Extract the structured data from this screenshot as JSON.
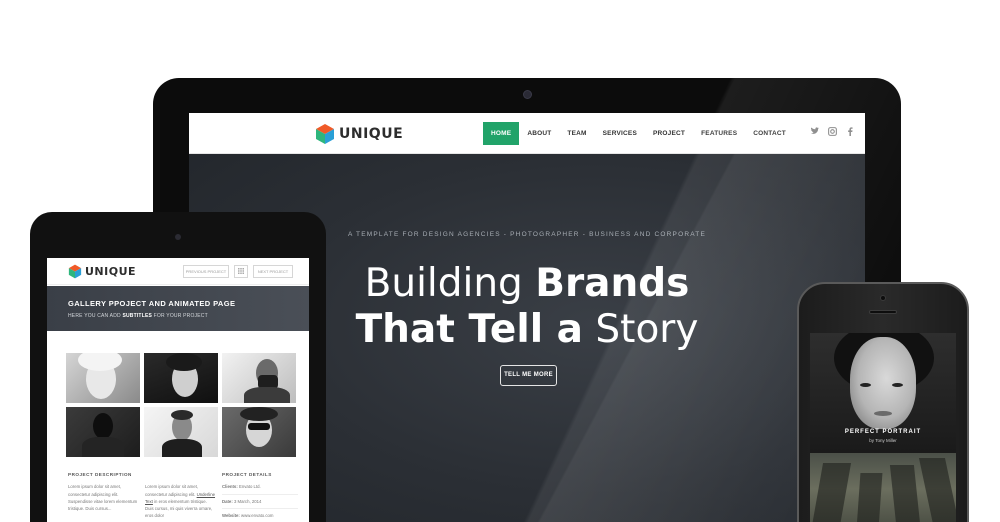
{
  "desktop": {
    "logo_text": "UNIQUE",
    "menu": [
      "HOME",
      "ABOUT",
      "TEAM",
      "SERVICES",
      "PROJECT",
      "FEATURES",
      "CONTACT"
    ],
    "active_menu": "HOME",
    "socials": [
      "twitter-icon",
      "instagram-icon",
      "facebook-icon"
    ],
    "hero": {
      "tagline": "A TEMPLATE FOR DESIGN AGENCIES - PHOTOGRAPHER - BUSINESS AND CORPORATE",
      "line1_thin": "Building",
      "line1_bold": "Brands",
      "line2_bold": "That Tell a",
      "line2_thin": "Story",
      "button": "TELL ME MORE"
    }
  },
  "tablet": {
    "logo_text": "UNIQUE",
    "prev_button": "PREVIOUS PROJECT",
    "next_button": "NEXT PROJECT",
    "banner_title": "GALLERY PPOJECT AND ANIMATED PAGE",
    "banner_sub_pre": "HERE YOU CAN ADD",
    "banner_sub_bold": "SUBTITLES",
    "banner_sub_post": "FOR YOUR PROJECT",
    "description_heading": "PROJECT DESCRIPTION",
    "description_text": "Lorem ipsum dolor sit amet, consectetur adipiscing elit. Suspendisse vitae lorem elementum tristique. Duis cursus...",
    "description_text2_pre": "Lorem ipsum dolor sit amet, consectetur adipiscing elit.",
    "description_link": "Underline Text",
    "description_text2_post": "in eros elementum tristique. Duis cursus, mi quis viverra ornare, eros dolor",
    "details_heading": "PROJECT DETAILS",
    "details": [
      {
        "label": "Clients:",
        "value": "Envato Ltd."
      },
      {
        "label": "Date:",
        "value": "3 March, 2014"
      },
      {
        "label": "Website:",
        "value": "www.envato.com"
      }
    ]
  },
  "phone": {
    "portrait_title": "PERFECT PORTRAIT",
    "portrait_sub": "by Tony Miller"
  },
  "colors": {
    "accent": "#21a369",
    "hero_bg": "#2b2f35"
  }
}
